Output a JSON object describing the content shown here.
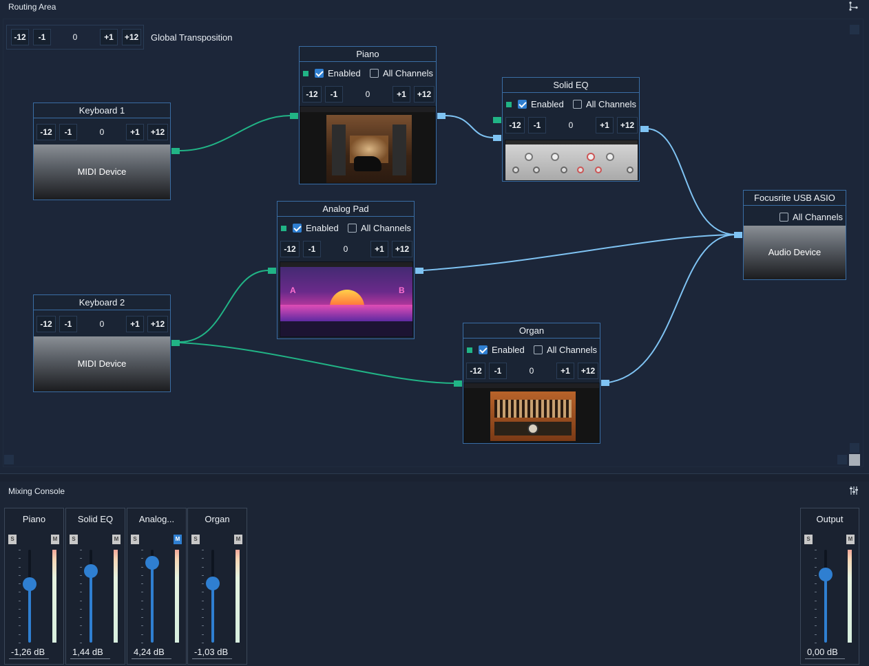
{
  "routing": {
    "title": "Routing Area",
    "global": {
      "label": "Global Transposition",
      "m12": "-12",
      "m1": "-1",
      "val": "0",
      "p1": "+1",
      "p12": "+12"
    }
  },
  "nodes": {
    "keyboard1": {
      "title": "Keyboard 1",
      "m12": "-12",
      "m1": "-1",
      "val": "0",
      "p1": "+1",
      "p12": "+12",
      "body": "MIDI Device"
    },
    "keyboard2": {
      "title": "Keyboard 2",
      "m12": "-12",
      "m1": "-1",
      "val": "0",
      "p1": "+1",
      "p12": "+12",
      "body": "MIDI Device"
    },
    "piano": {
      "title": "Piano",
      "enabled": "Enabled",
      "all": "All Channels",
      "m12": "-12",
      "m1": "-1",
      "val": "0",
      "p1": "+1",
      "p12": "+12"
    },
    "solideq": {
      "title": "Solid EQ",
      "enabled": "Enabled",
      "all": "All Channels",
      "m12": "-12",
      "m1": "-1",
      "val": "0",
      "p1": "+1",
      "p12": "+12"
    },
    "analogpad": {
      "title": "Analog Pad",
      "enabled": "Enabled",
      "all": "All Channels",
      "m12": "-12",
      "m1": "-1",
      "val": "0",
      "p1": "+1",
      "p12": "+12"
    },
    "organ": {
      "title": "Organ",
      "enabled": "Enabled",
      "all": "All Channels",
      "m12": "-12",
      "m1": "-1",
      "val": "0",
      "p1": "+1",
      "p12": "+12"
    },
    "focusrite": {
      "title": "Focusrite USB ASIO",
      "all": "All Channels",
      "body": "Audio Device"
    }
  },
  "mixer": {
    "title": "Mixing Console",
    "solo": "S",
    "mute": "M",
    "strips": [
      {
        "name": "Piano",
        "db": "-1,26 dB",
        "level": 0.63,
        "muted": false
      },
      {
        "name": "Solid EQ",
        "db": "1,44 dB",
        "level": 0.77,
        "muted": false
      },
      {
        "name": "Analog...",
        "db": "4,24 dB",
        "level": 0.86,
        "muted": true
      },
      {
        "name": "Organ",
        "db": "-1,03 dB",
        "level": 0.64,
        "muted": false
      },
      {
        "name": "Output",
        "db": "0,00 dB",
        "level": 0.73,
        "muted": false
      }
    ]
  },
  "colors": {
    "midi_cable": "#21b486",
    "audio_cable": "#7fc3f3",
    "accent": "#2f7fd1"
  },
  "icons": [
    "routing-icon",
    "mixer-settings-icon"
  ]
}
